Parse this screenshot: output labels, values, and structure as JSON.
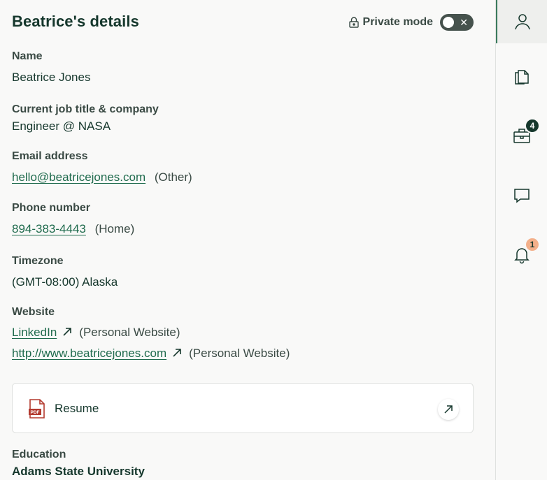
{
  "header": {
    "title": "Beatrice's details",
    "private_mode_label": "Private mode"
  },
  "fields": {
    "name": {
      "label": "Name",
      "value": "Beatrice Jones"
    },
    "job": {
      "label": "Current job title & company",
      "value": "Engineer @ NASA"
    },
    "email": {
      "label": "Email address",
      "value": "hello@beatricejones.com",
      "type": "(Other)"
    },
    "phone": {
      "label": "Phone number",
      "value": "894-383-4443",
      "type": "(Home)"
    },
    "timezone": {
      "label": "Timezone",
      "value": "(GMT-08:00) Alaska"
    },
    "website": {
      "label": "Website",
      "links": [
        {
          "text": "LinkedIn",
          "type": "(Personal Website)"
        },
        {
          "text": "http://www.beatricejones.com",
          "type": "(Personal Website)"
        }
      ]
    }
  },
  "resume": {
    "label": "Resume"
  },
  "education": {
    "label": "Education",
    "school": "Adams State University"
  },
  "sidebar": {
    "jobs_badge": "4",
    "notifications_badge": "1"
  },
  "colors": {
    "primary": "#15372c",
    "link": "#1f6b4d",
    "badge_dark": "#15372c",
    "badge_peach": "#f3b08a",
    "pdf_red": "#b33a2f"
  }
}
